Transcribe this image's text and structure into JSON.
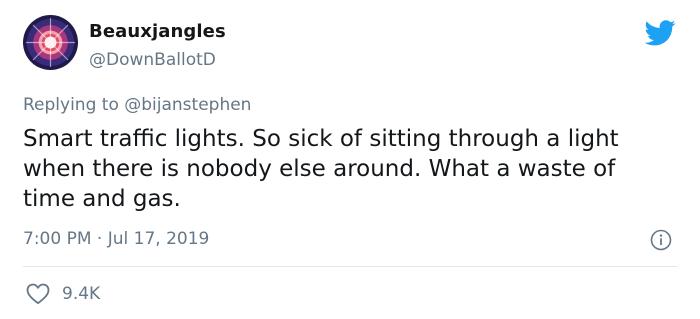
{
  "tweet": {
    "display_name": "Beauxjangles",
    "handle": "@DownBallotD",
    "replying_prefix": "Replying to",
    "replying_to": "@bijanstephen",
    "text": "Smart traffic lights. So sick of sitting through a light when there is nobody else around. What a waste of time and gas.",
    "time": "7:00 PM",
    "separator": "·",
    "date": "Jul 17, 2019",
    "likes": "9.4K"
  },
  "icons": {
    "brand": "twitter-bird-icon",
    "info": "info-icon",
    "like": "heart-icon"
  },
  "colors": {
    "brand": "#1da1f2",
    "secondary_text": "#657786",
    "primary_text": "#14171a",
    "divider": "#e1e8ed"
  }
}
